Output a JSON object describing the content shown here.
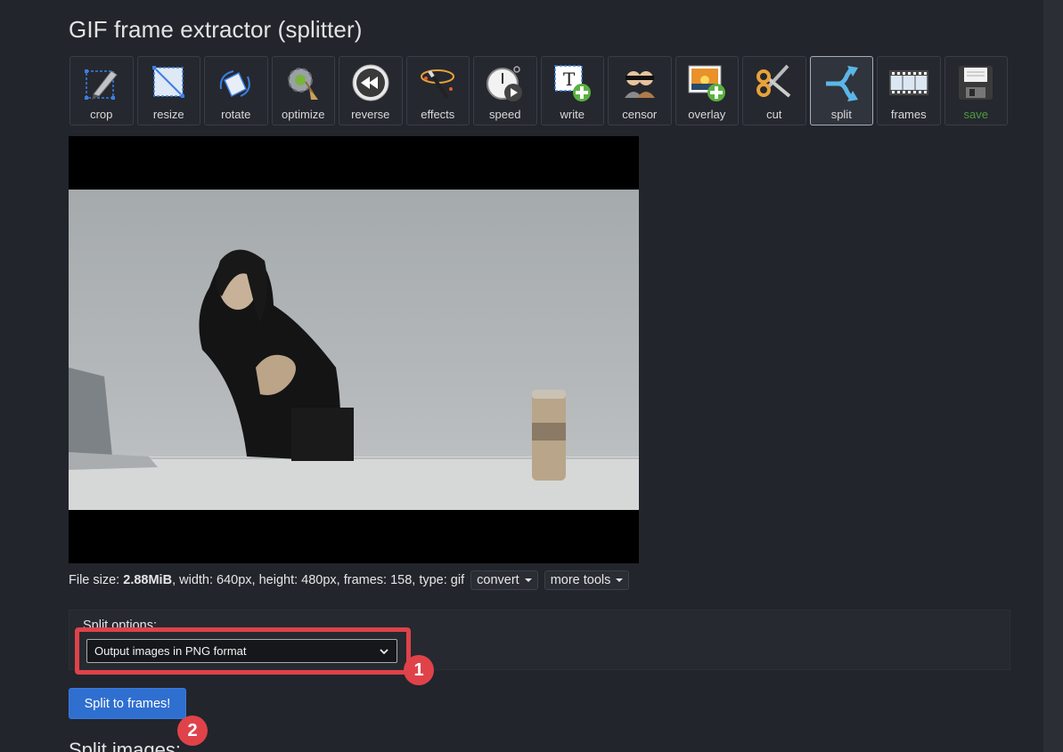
{
  "page": {
    "title": "GIF frame extractor (splitter)",
    "split_images_heading": "Split images:"
  },
  "toolbar": {
    "tools": [
      {
        "label": "crop",
        "icon": "crop-icon"
      },
      {
        "label": "resize",
        "icon": "resize-icon"
      },
      {
        "label": "rotate",
        "icon": "rotate-icon"
      },
      {
        "label": "optimize",
        "icon": "optimize-icon"
      },
      {
        "label": "reverse",
        "icon": "reverse-icon"
      },
      {
        "label": "effects",
        "icon": "effects-icon"
      },
      {
        "label": "speed",
        "icon": "speed-icon"
      },
      {
        "label": "write",
        "icon": "write-icon"
      },
      {
        "label": "censor",
        "icon": "censor-icon"
      },
      {
        "label": "overlay",
        "icon": "overlay-icon"
      },
      {
        "label": "cut",
        "icon": "cut-icon"
      },
      {
        "label": "split",
        "icon": "split-icon",
        "active": true
      },
      {
        "label": "frames",
        "icon": "frames-icon"
      },
      {
        "label": "save",
        "icon": "save-icon",
        "color": "#4f9a3c"
      }
    ]
  },
  "file_info": {
    "prefix": "File size: ",
    "size": "2.88MiB",
    "rest": ", width: 640px, height: 480px, frames: 158, type: gif",
    "convert_label": "convert",
    "more_tools_label": "more tools"
  },
  "split_options": {
    "legend": "Split options:",
    "selected": "Output images in PNG format"
  },
  "actions": {
    "split_button": "Split to frames!"
  },
  "annotations": {
    "badge1": "1",
    "badge2": "2",
    "highlight_color": "#e0424a"
  },
  "colors": {
    "background": "#22252c",
    "primary_button": "#2f6fd0"
  }
}
